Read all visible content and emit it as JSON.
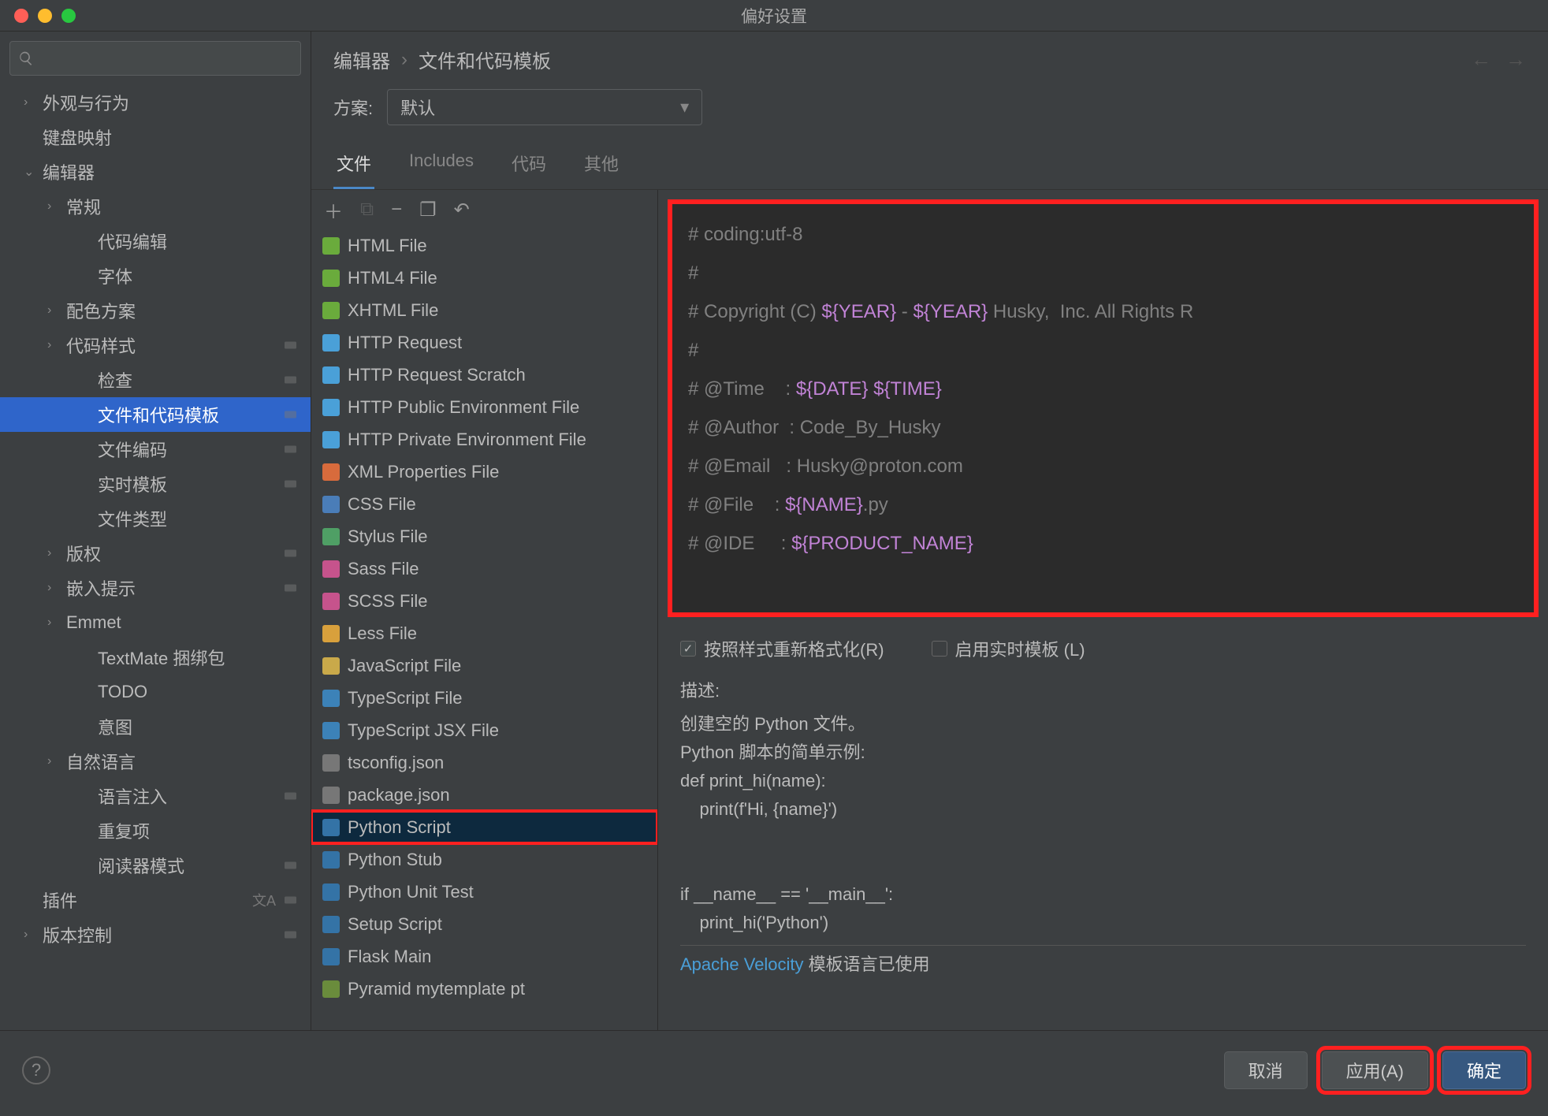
{
  "window": {
    "title": "偏好设置"
  },
  "breadcrumb": {
    "first": "编辑器",
    "second": "文件和代码模板"
  },
  "scheme": {
    "label": "方案:",
    "value": "默认"
  },
  "sidebar": {
    "items": [
      {
        "label": "外观与行为",
        "depth": 0,
        "chev": "›"
      },
      {
        "label": "键盘映射",
        "depth": 0,
        "chev": ""
      },
      {
        "label": "编辑器",
        "depth": 0,
        "chev": "⌄"
      },
      {
        "label": "常规",
        "depth": 1,
        "chev": "›"
      },
      {
        "label": "代码编辑",
        "depth": 2,
        "chev": ""
      },
      {
        "label": "字体",
        "depth": 2,
        "chev": ""
      },
      {
        "label": "配色方案",
        "depth": 1,
        "chev": "›"
      },
      {
        "label": "代码样式",
        "depth": 1,
        "chev": "›",
        "badge": true
      },
      {
        "label": "检查",
        "depth": 2,
        "chev": "",
        "badge": true
      },
      {
        "label": "文件和代码模板",
        "depth": 2,
        "chev": "",
        "sel": true,
        "badge": true
      },
      {
        "label": "文件编码",
        "depth": 2,
        "chev": "",
        "badge": true
      },
      {
        "label": "实时模板",
        "depth": 2,
        "chev": "",
        "badge": true
      },
      {
        "label": "文件类型",
        "depth": 2,
        "chev": ""
      },
      {
        "label": "版权",
        "depth": 1,
        "chev": "›",
        "badge": true
      },
      {
        "label": "嵌入提示",
        "depth": 1,
        "chev": "›",
        "badge": true
      },
      {
        "label": "Emmet",
        "depth": 1,
        "chev": "›"
      },
      {
        "label": "TextMate 捆绑包",
        "depth": 2,
        "chev": ""
      },
      {
        "label": "TODO",
        "depth": 2,
        "chev": ""
      },
      {
        "label": "意图",
        "depth": 2,
        "chev": ""
      },
      {
        "label": "自然语言",
        "depth": 1,
        "chev": "›"
      },
      {
        "label": "语言注入",
        "depth": 2,
        "chev": "",
        "badge": true
      },
      {
        "label": "重复项",
        "depth": 2,
        "chev": ""
      },
      {
        "label": "阅读器模式",
        "depth": 2,
        "chev": "",
        "badge": true
      },
      {
        "label": "插件",
        "depth": 0,
        "chev": "",
        "lang": true,
        "badge": true
      },
      {
        "label": "版本控制",
        "depth": 0,
        "chev": "›",
        "badge": true
      }
    ]
  },
  "tabs": [
    {
      "label": "文件",
      "active": true
    },
    {
      "label": "Includes"
    },
    {
      "label": "代码"
    },
    {
      "label": "其他"
    }
  ],
  "templates": [
    {
      "label": "HTML File",
      "icon": "h"
    },
    {
      "label": "HTML4 File",
      "icon": "h"
    },
    {
      "label": "XHTML File",
      "icon": "h"
    },
    {
      "label": "HTTP Request",
      "icon": "api"
    },
    {
      "label": "HTTP Request Scratch",
      "icon": "api"
    },
    {
      "label": "HTTP Public Environment File",
      "icon": "api"
    },
    {
      "label": "HTTP Private Environment File",
      "icon": "api"
    },
    {
      "label": "XML Properties File",
      "icon": "xml"
    },
    {
      "label": "CSS File",
      "icon": "css"
    },
    {
      "label": "Stylus File",
      "icon": "styl"
    },
    {
      "label": "Sass File",
      "icon": "sass"
    },
    {
      "label": "SCSS File",
      "icon": "sass"
    },
    {
      "label": "Less File",
      "icon": "less"
    },
    {
      "label": "JavaScript File",
      "icon": "js"
    },
    {
      "label": "TypeScript File",
      "icon": "ts"
    },
    {
      "label": "TypeScript JSX File",
      "icon": "ts"
    },
    {
      "label": "tsconfig.json",
      "icon": "json"
    },
    {
      "label": "package.json",
      "icon": "json"
    },
    {
      "label": "Python Script",
      "icon": "py",
      "sel": true,
      "boxed": true
    },
    {
      "label": "Python Stub",
      "icon": "py"
    },
    {
      "label": "Python Unit Test",
      "icon": "py"
    },
    {
      "label": "Setup Script",
      "icon": "py"
    },
    {
      "label": "Flask Main",
      "icon": "py"
    },
    {
      "label": "Pyramid mytemplate pt",
      "icon": "other"
    }
  ],
  "code": {
    "l1": "# coding:utf-8",
    "l2": "#",
    "l3a": "# Copyright (C) ",
    "l3b": "${YEAR}",
    "l3c": " - ",
    "l3d": "${YEAR}",
    "l3e": " Husky,  Inc. All Rights R",
    "l4": "#",
    "l5a": "# @Time    : ",
    "l5b": "${DATE}",
    "l5c": " ",
    "l5d": "${TIME}",
    "l6": "# @Author  : Code_By_Husky",
    "l7": "# @Email   : Husky@proton.com",
    "l8a": "# @File    : ",
    "l8b": "${NAME}",
    "l8c": ".py",
    "l9a": "# @IDE     : ",
    "l9b": "${PRODUCT_NAME}"
  },
  "checks": {
    "reformat": "按照样式重新格式化(R)",
    "live": "启用实时模板 (L)"
  },
  "desc": {
    "label": "描述:",
    "body": "创建空的 Python 文件。\nPython 脚本的简单示例:\ndef print_hi(name):\n    print(f'Hi, {name}')\n\n\nif __name__ == '__main__':\n    print_hi('Python')",
    "link": "Apache Velocity",
    "linktail": " 模板语言已使用"
  },
  "buttons": {
    "cancel": "取消",
    "apply": "应用(A)",
    "ok": "确定"
  }
}
